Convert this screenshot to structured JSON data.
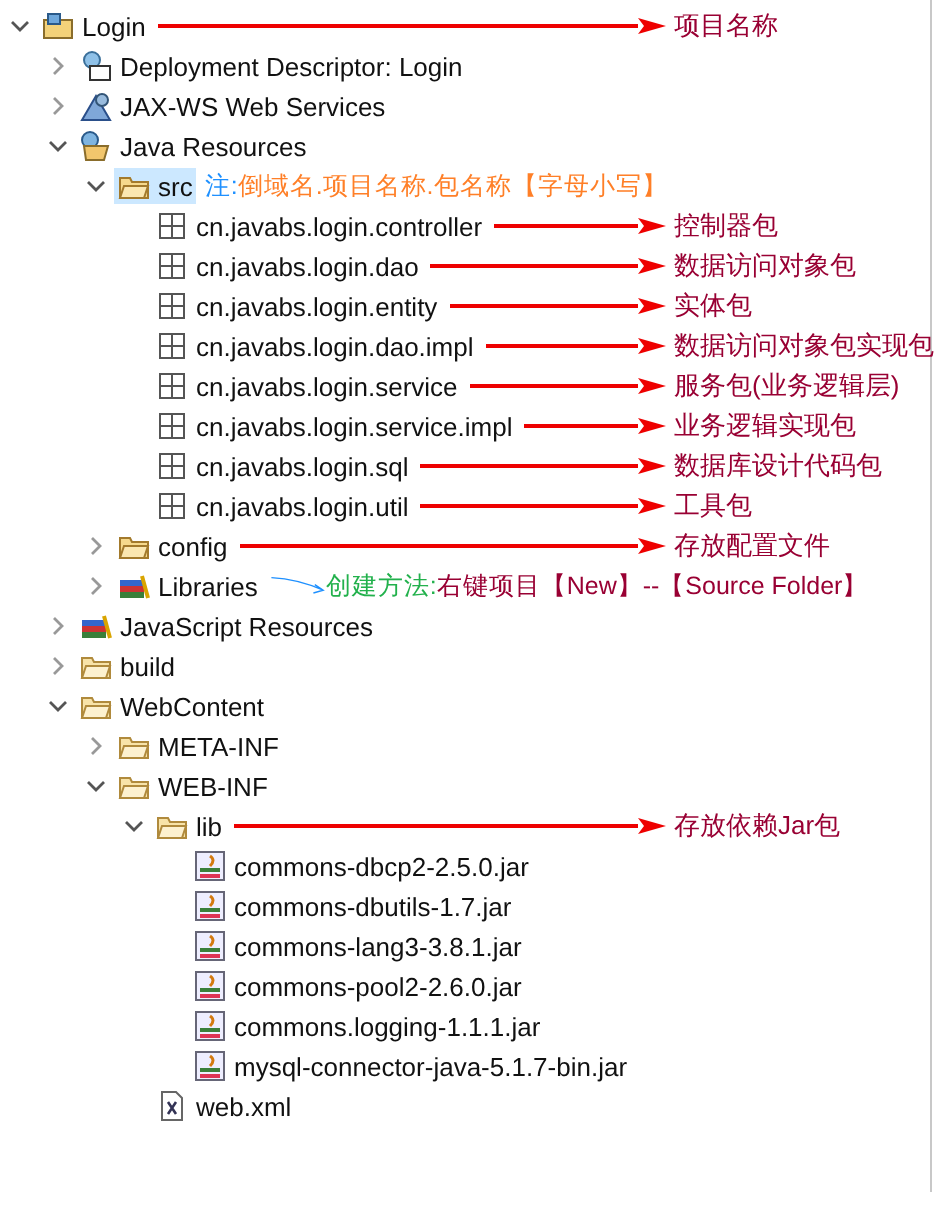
{
  "tree": {
    "items": [
      {
        "label": "Login",
        "kind": "project",
        "expanded": true,
        "selected": false,
        "note": {
          "kind": "arrow",
          "parts": [
            {
              "text": "项目名称",
              "color": "#990033"
            }
          ]
        },
        "children": [
          {
            "label": "Deployment Descriptor: Login",
            "kind": "descriptor",
            "expanded": false,
            "selected": false
          },
          {
            "label": "JAX-WS Web Services",
            "kind": "webservice",
            "expanded": false,
            "selected": false
          },
          {
            "label": "Java Resources",
            "kind": "javares",
            "expanded": true,
            "selected": false,
            "children": [
              {
                "label": "src",
                "kind": "srcfolder",
                "expanded": true,
                "selected": true,
                "note": {
                  "kind": "inline",
                  "parts": [
                    {
                      "text": "注:",
                      "color": "#1e90ff"
                    },
                    {
                      "text": "倒域名.项目名称.包名称【字母小写】",
                      "color": "#ff7f27"
                    }
                  ]
                },
                "children": [
                  {
                    "label": "cn.javabs.login.controller",
                    "kind": "package",
                    "selected": false,
                    "note": {
                      "kind": "arrow",
                      "parts": [
                        {
                          "text": "控制器包",
                          "color": "#990033"
                        }
                      ]
                    }
                  },
                  {
                    "label": "cn.javabs.login.dao",
                    "kind": "package",
                    "selected": false,
                    "note": {
                      "kind": "arrow",
                      "parts": [
                        {
                          "text": "数据访问对象包",
                          "color": "#990033"
                        }
                      ]
                    }
                  },
                  {
                    "label": "cn.javabs.login.entity",
                    "kind": "package",
                    "selected": false,
                    "note": {
                      "kind": "arrow",
                      "parts": [
                        {
                          "text": "实体包",
                          "color": "#990033"
                        }
                      ]
                    }
                  },
                  {
                    "label": "cn.javabs.login.dao.impl",
                    "kind": "package",
                    "selected": false,
                    "note": {
                      "kind": "arrow",
                      "parts": [
                        {
                          "text": "数据访问对象包实现包",
                          "color": "#990033"
                        }
                      ]
                    }
                  },
                  {
                    "label": "cn.javabs.login.service",
                    "kind": "package",
                    "selected": false,
                    "note": {
                      "kind": "arrow",
                      "parts": [
                        {
                          "text": "服务包(业务逻辑层)",
                          "color": "#990033"
                        }
                      ]
                    }
                  },
                  {
                    "label": "cn.javabs.login.service.impl",
                    "kind": "package",
                    "selected": false,
                    "note": {
                      "kind": "arrow",
                      "parts": [
                        {
                          "text": "业务逻辑实现包",
                          "color": "#990033"
                        }
                      ]
                    }
                  },
                  {
                    "label": "cn.javabs.login.sql",
                    "kind": "package",
                    "selected": false,
                    "note": {
                      "kind": "arrow",
                      "parts": [
                        {
                          "text": "数据库设计代码包",
                          "color": "#990033"
                        }
                      ]
                    }
                  },
                  {
                    "label": "cn.javabs.login.util",
                    "kind": "package",
                    "selected": false,
                    "note": {
                      "kind": "arrow",
                      "parts": [
                        {
                          "text": "工具包",
                          "color": "#990033"
                        }
                      ]
                    }
                  }
                ]
              },
              {
                "label": "config",
                "kind": "srcfolder",
                "expanded": false,
                "selected": false,
                "note": {
                  "kind": "arrow",
                  "parts": [
                    {
                      "text": "存放配置文件",
                      "color": "#990033"
                    }
                  ]
                }
              },
              {
                "label": "Libraries",
                "kind": "library",
                "expanded": false,
                "selected": false,
                "note": {
                  "kind": "callout",
                  "parts": [
                    {
                      "text": "创建方法:",
                      "color": "#22b14c"
                    },
                    {
                      "text": "右键项目【New】--【Source Folder】",
                      "color": "#990033"
                    }
                  ]
                }
              }
            ]
          },
          {
            "label": "JavaScript Resources",
            "kind": "library",
            "expanded": false,
            "selected": false
          },
          {
            "label": "build",
            "kind": "folder",
            "expanded": false,
            "selected": false
          },
          {
            "label": "WebContent",
            "kind": "folder",
            "expanded": true,
            "selected": false,
            "children": [
              {
                "label": "META-INF",
                "kind": "folder",
                "expanded": false,
                "selected": false
              },
              {
                "label": "WEB-INF",
                "kind": "folder",
                "expanded": true,
                "selected": false,
                "children": [
                  {
                    "label": "lib",
                    "kind": "folder",
                    "expanded": true,
                    "selected": false,
                    "note": {
                      "kind": "arrow",
                      "parts": [
                        {
                          "text": "存放依赖Jar包",
                          "color": "#990033"
                        }
                      ]
                    },
                    "children": [
                      {
                        "label": "commons-dbcp2-2.5.0.jar",
                        "kind": "jar",
                        "selected": false
                      },
                      {
                        "label": "commons-dbutils-1.7.jar",
                        "kind": "jar",
                        "selected": false
                      },
                      {
                        "label": "commons-lang3-3.8.1.jar",
                        "kind": "jar",
                        "selected": false
                      },
                      {
                        "label": "commons-pool2-2.6.0.jar",
                        "kind": "jar",
                        "selected": false
                      },
                      {
                        "label": "commons.logging-1.1.1.jar",
                        "kind": "jar",
                        "selected": false
                      },
                      {
                        "label": "mysql-connector-java-5.1.7-bin.jar",
                        "kind": "jar",
                        "selected": false
                      }
                    ]
                  },
                  {
                    "label": "web.xml",
                    "kind": "xml",
                    "selected": false
                  }
                ]
              }
            ]
          }
        ]
      }
    ]
  }
}
